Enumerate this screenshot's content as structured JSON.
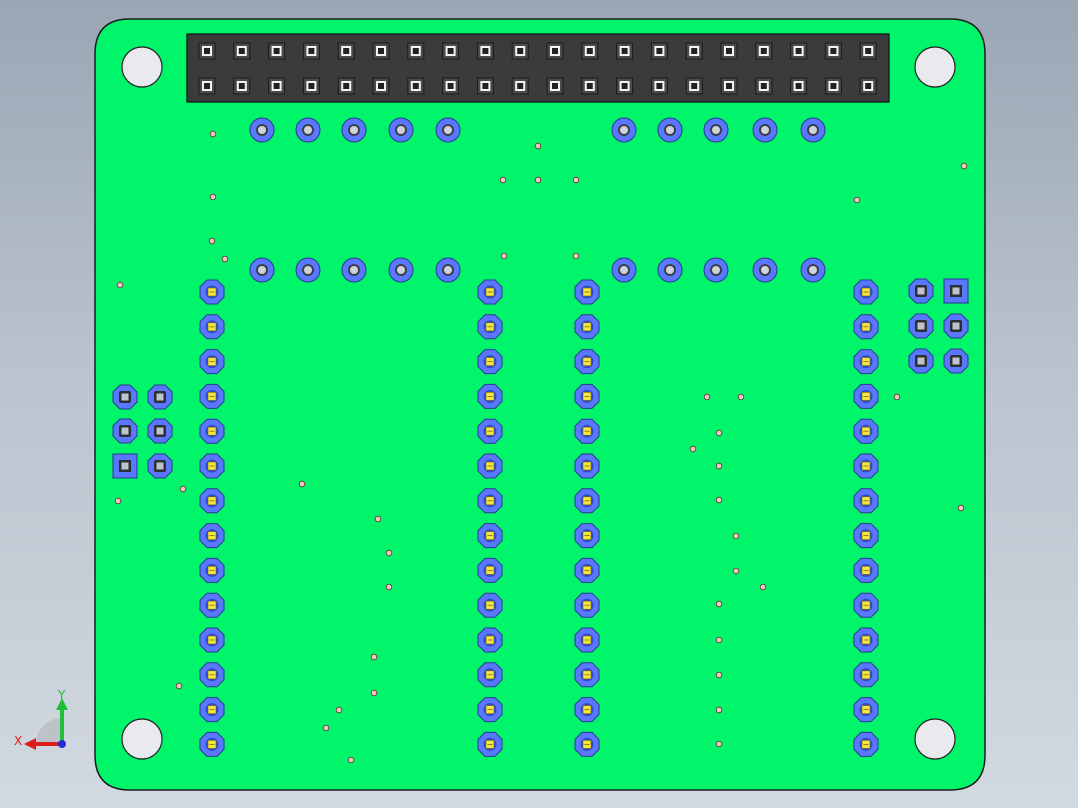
{
  "viewport": {
    "background": "gradient-gray",
    "board_color": "#00f56a",
    "pad_color": "#5a78ff",
    "connector_color": "#3b3b3b",
    "hole_fill": "#e8eaee",
    "yellow_pin_color": "#f2e640"
  },
  "triad": {
    "x_label": "X",
    "y_label": "Y",
    "x_color": "#e01b1b",
    "y_color": "#1fbf3a",
    "z_color": "#1f2fd6"
  },
  "components": {
    "header_40pin": {
      "rows": 2,
      "pins_per_row": 20
    },
    "jumper_left": {
      "rows": 3,
      "cols": 2,
      "square_pin": "bottom-left"
    },
    "jumper_right": {
      "rows": 3,
      "cols": 2,
      "square_pin": "top-right"
    },
    "pin_columns": {
      "count": 4,
      "pins_per_column": 14,
      "pin_marking": "yellow"
    },
    "top_pad_rows": {
      "rows": 2,
      "pads_per_group": 5,
      "groups": 2
    },
    "mounting_holes": 4
  }
}
